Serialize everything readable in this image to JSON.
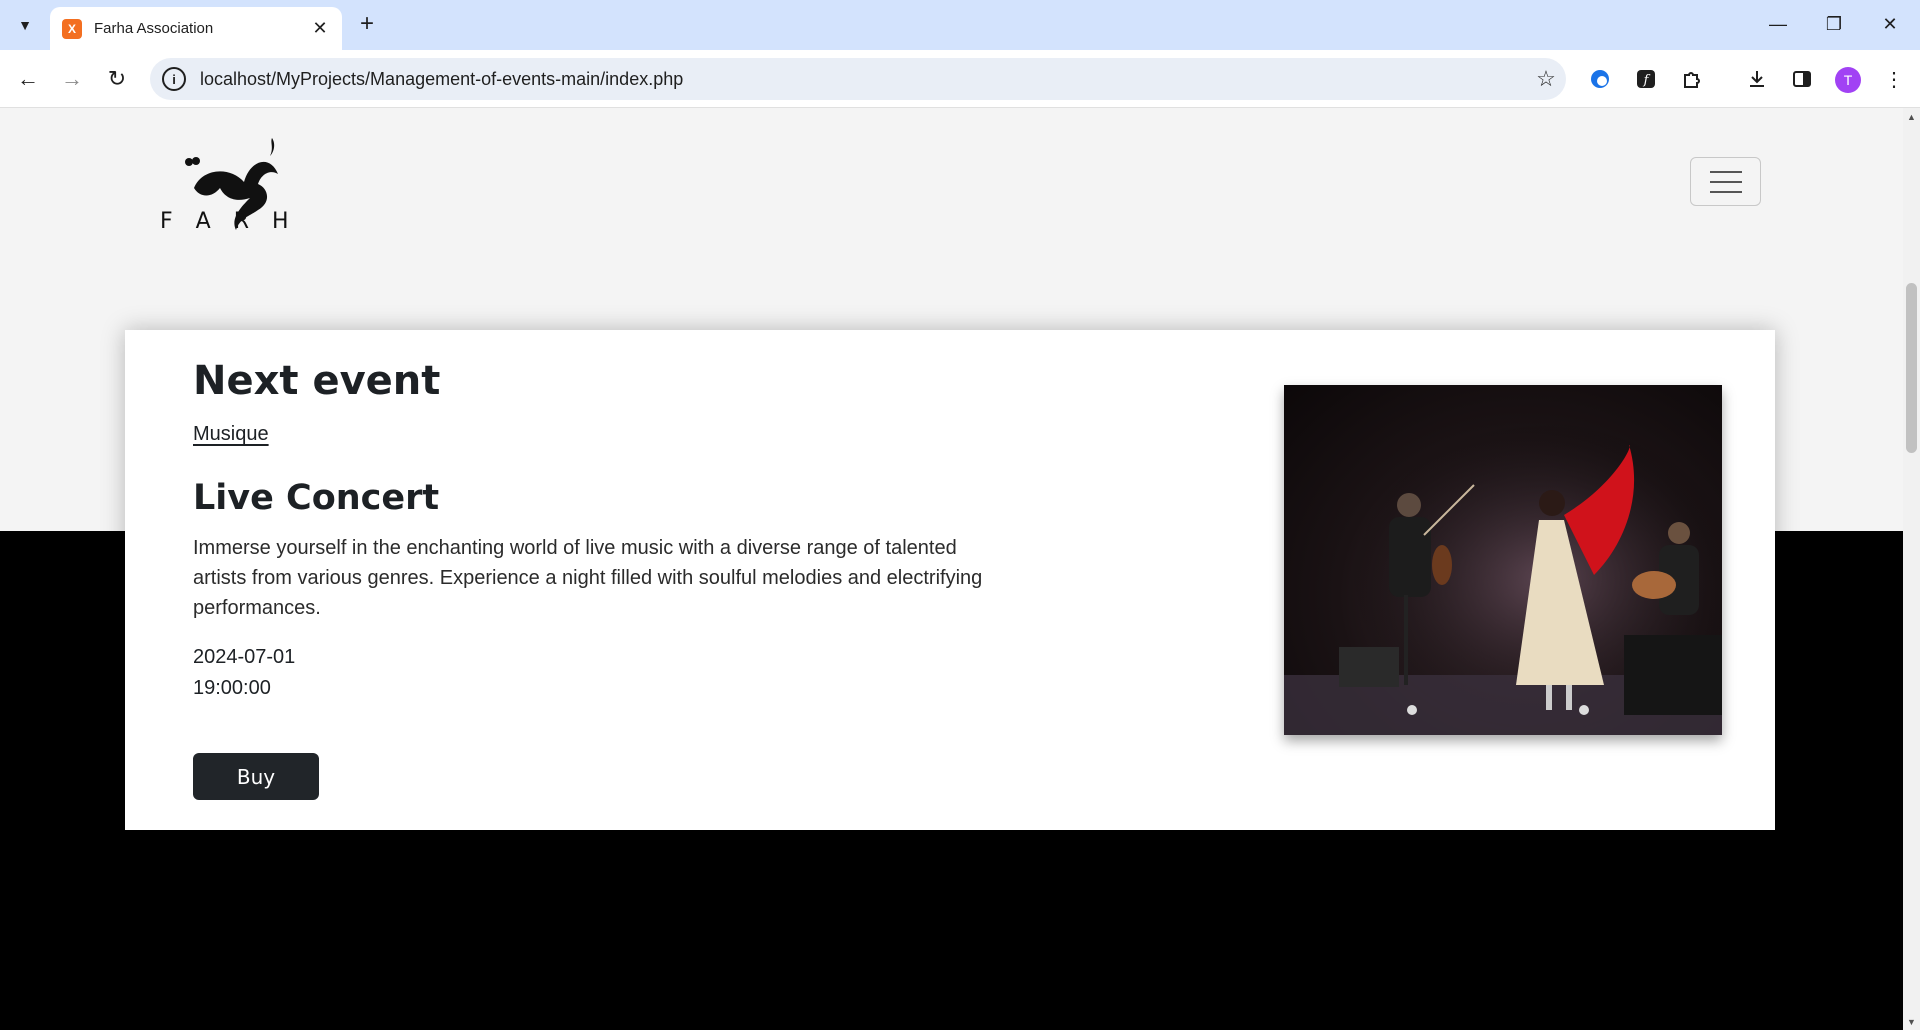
{
  "browser": {
    "tab_title": "Farha Association",
    "tab_close": "✕",
    "new_tab": "+",
    "url": "localhost/MyProjects/Management-of-events-main/index.php",
    "profile_initial": "T",
    "window_controls": {
      "minimize": "—",
      "restore": "❐",
      "close": "✕"
    }
  },
  "site": {
    "logo_letters": "F A R H A"
  },
  "next_event": {
    "heading": "Next event",
    "category": "Musique",
    "title": "Live Concert",
    "description": "Immerse yourself in the enchanting world of live music with a diverse range of talented artists from various genres. Experience a night filled with soulful melodies and electrifying performances.",
    "date": "2024-07-01",
    "time": "19:00:00",
    "buy_label": "Buy"
  }
}
